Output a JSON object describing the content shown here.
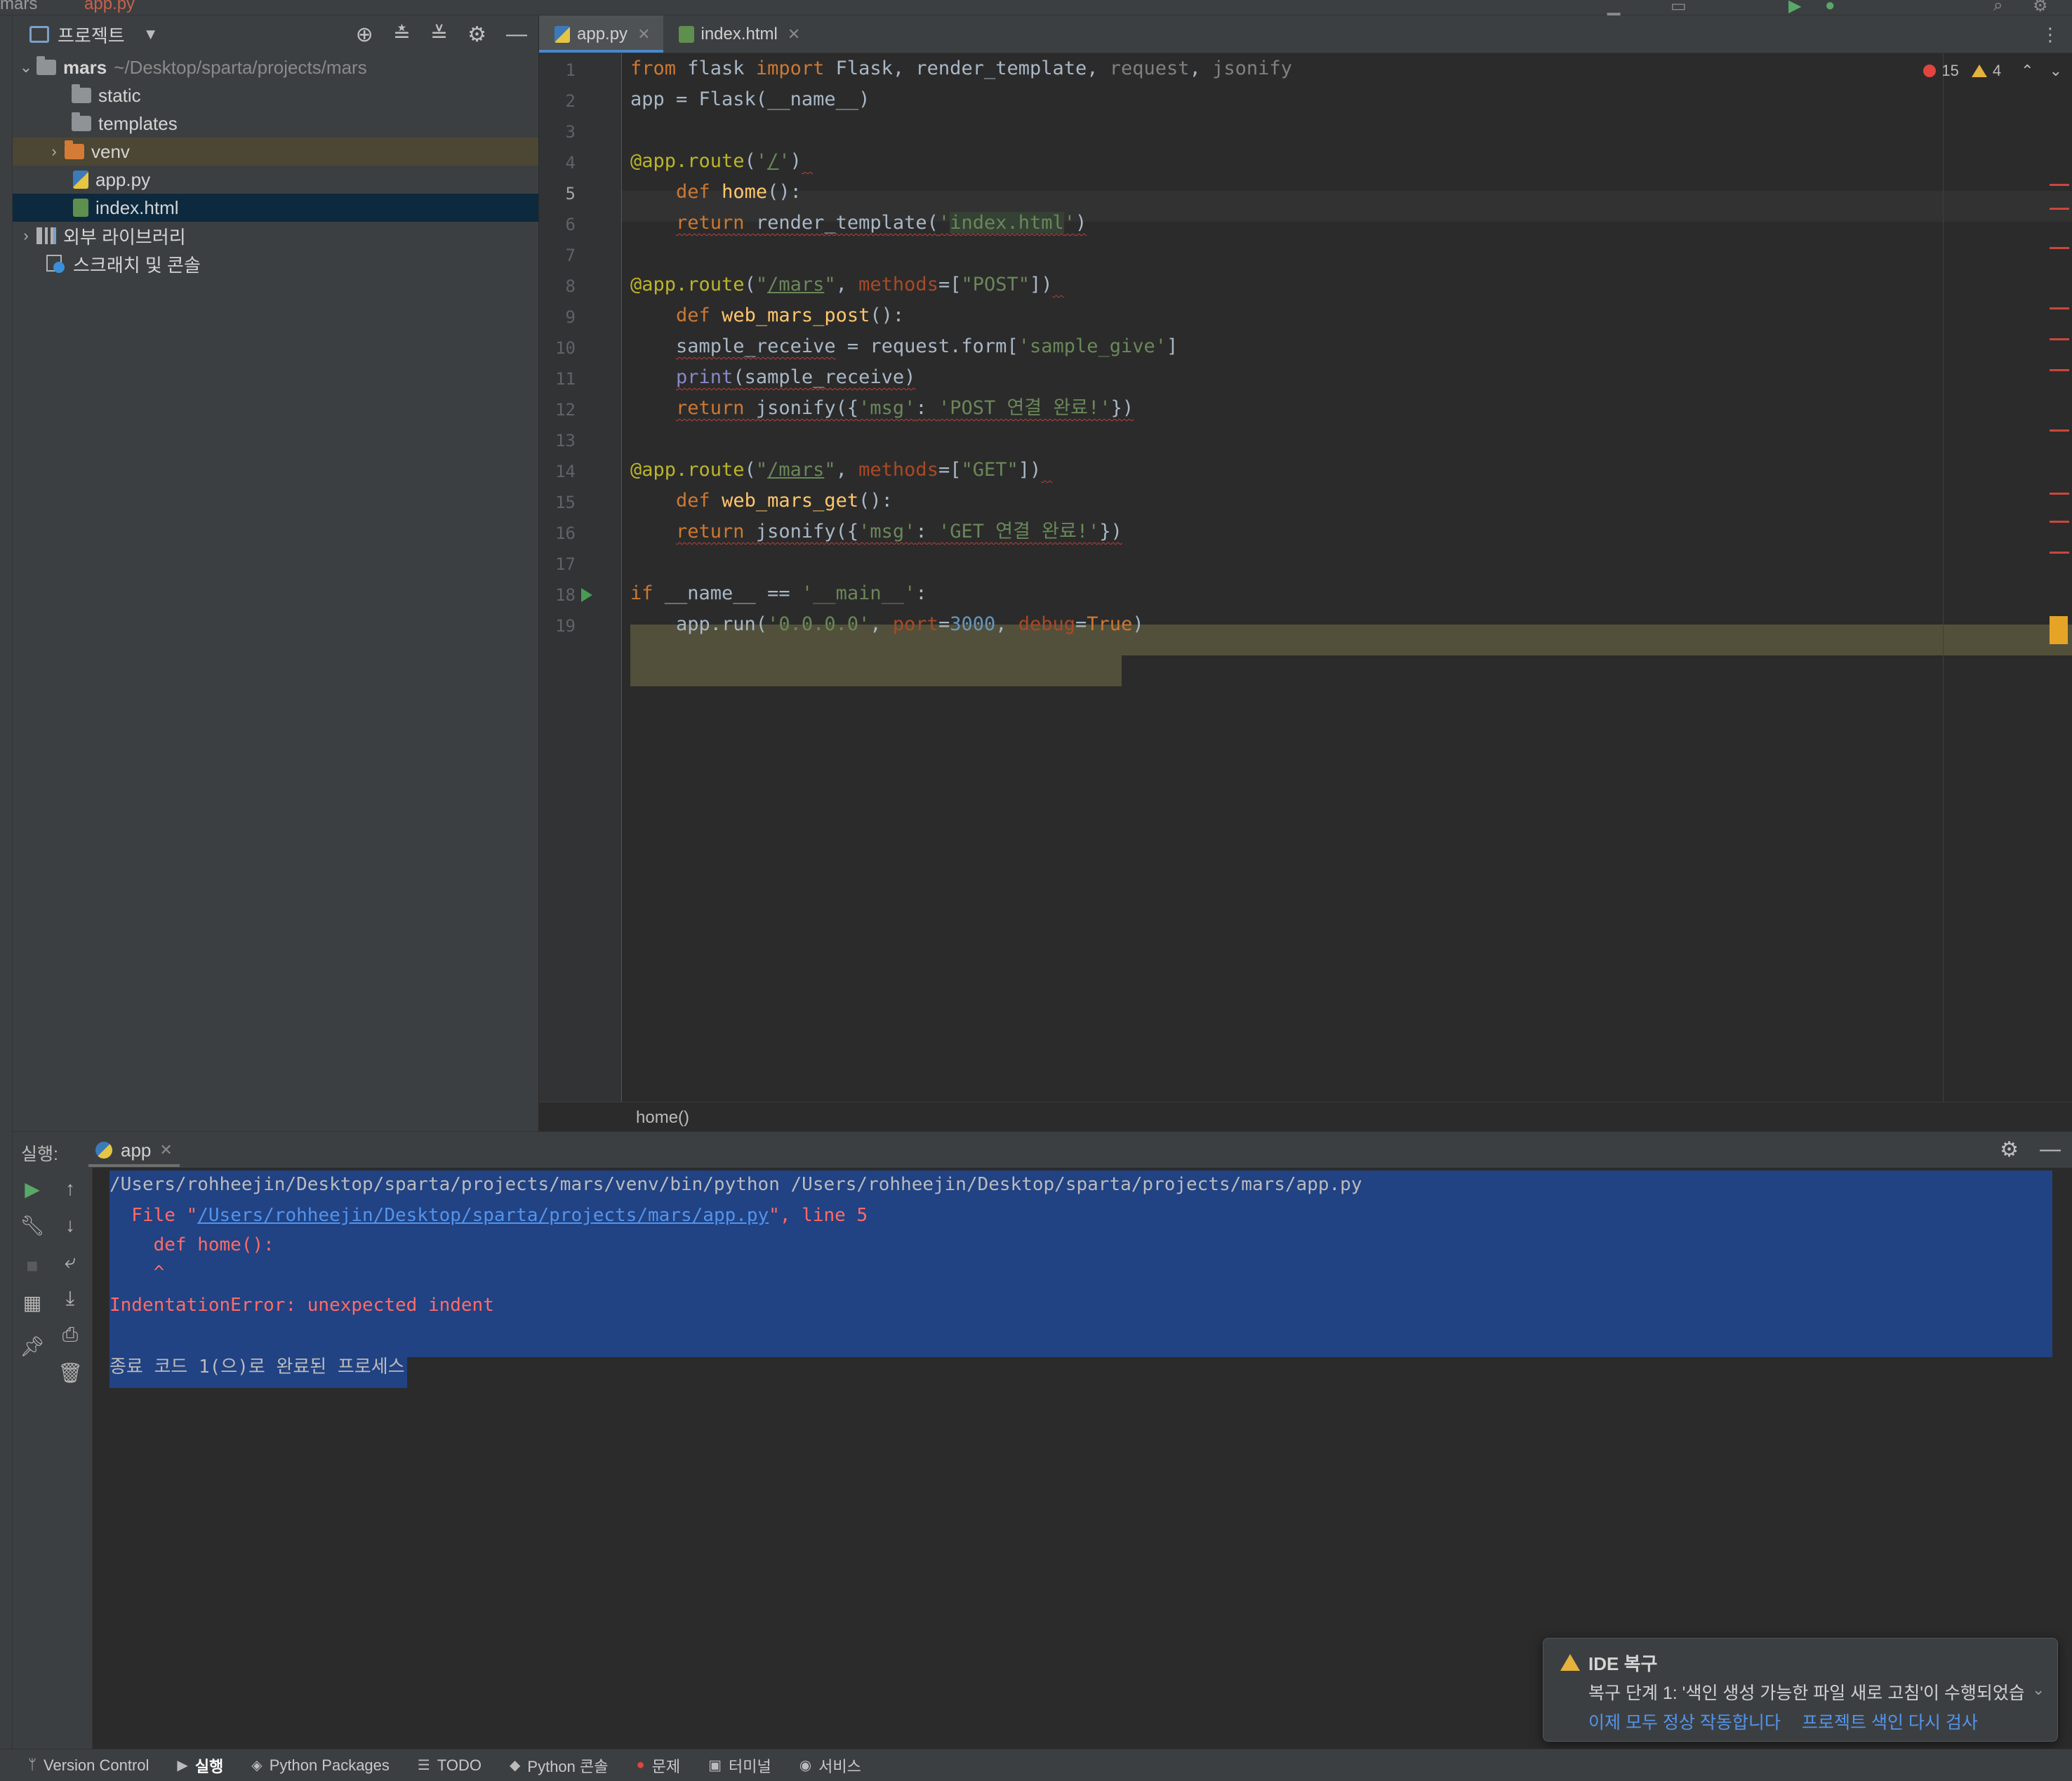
{
  "titlebar": {
    "crumb": "mars",
    "file": "app.py"
  },
  "project": {
    "title": "프로젝트",
    "tree": [
      {
        "name": "mars",
        "path": "~/Desktop/sparta/projects/mars"
      },
      {
        "name": "static"
      },
      {
        "name": "templates"
      },
      {
        "name": "venv"
      },
      {
        "name": "app.py"
      },
      {
        "name": "index.html"
      },
      {
        "name": "외부 라이브러리"
      },
      {
        "name": "스크래치 및 콘솔"
      }
    ]
  },
  "tabs": [
    {
      "label": "app.py",
      "active": true
    },
    {
      "label": "index.html",
      "active": false
    }
  ],
  "editor": {
    "errors": "15",
    "warnings": "4",
    "lines": [
      "1",
      "2",
      "3",
      "4",
      "5",
      "6",
      "7",
      "8",
      "9",
      "10",
      "11",
      "12",
      "13",
      "14",
      "15",
      "16",
      "17",
      "18",
      "19"
    ],
    "current_line": "5",
    "breadcrumb": "home()"
  },
  "run": {
    "label": "실행:",
    "tab": "app",
    "console": {
      "line1": "/Users/rohheejin/Desktop/sparta/projects/mars/venv/bin/python /Users/rohheejin/Desktop/sparta/projects/mars/app.py",
      "file_prefix": "  File \"",
      "file_link": "/Users/rohheejin/Desktop/sparta/projects/mars/app.py",
      "file_suffix": "\", line 5",
      "code_line": "    def home():",
      "caret": "    ^",
      "error": "IndentationError: unexpected indent",
      "exit": "종료 코드 1(으)로 완료된 프로세스"
    }
  },
  "notification": {
    "title": "IDE 복구",
    "body": "복구 단계 1: '색인 생성 가능한 파일 새로 고침'이 수행되었습니다",
    "link1": "이제 모두 정상 작동합니다",
    "link2": "프로젝트 색인 다시 검사"
  },
  "statusbar": {
    "items": [
      "Version Control",
      "실행",
      "Python Packages",
      "TODO",
      "Python 콘솔",
      "문제",
      "터미널",
      "서비스"
    ]
  },
  "colors": {
    "accent": "#4a88c7",
    "error": "#ff6b68",
    "selection": "#214283",
    "warning": "#e5b23b"
  }
}
